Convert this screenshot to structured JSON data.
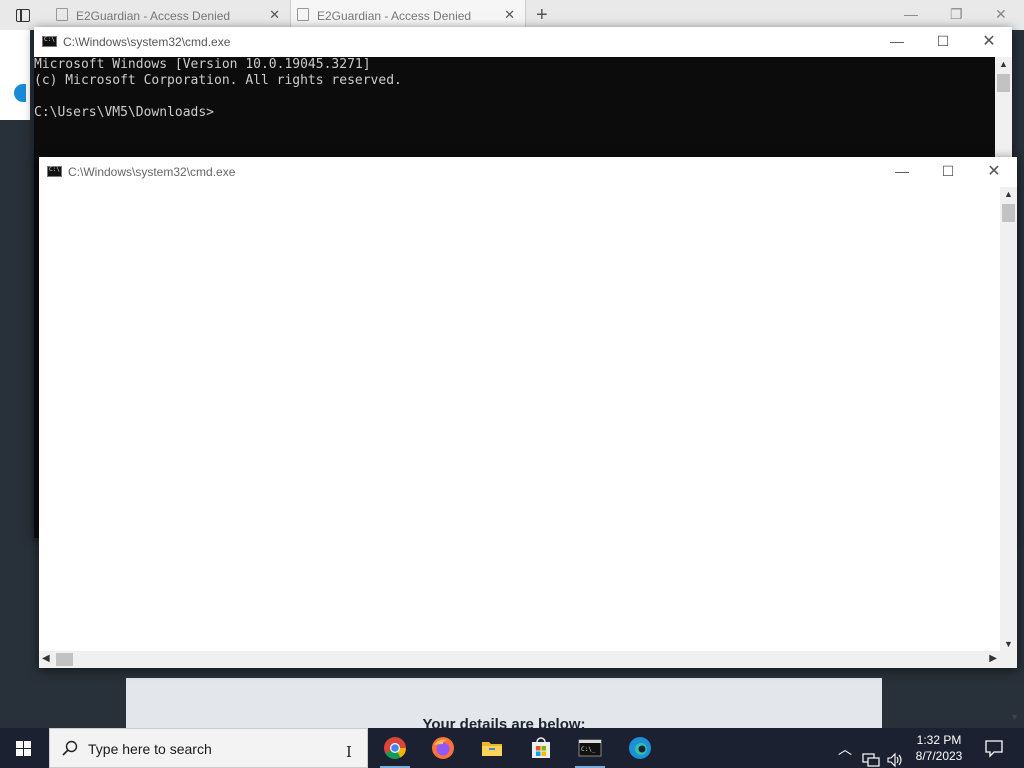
{
  "browser": {
    "tabs": [
      {
        "title": "E2Guardian - Access Denied"
      },
      {
        "title": "E2Guardian - Access Denied"
      }
    ],
    "page_heading": "Your details are below:"
  },
  "cmd_back": {
    "title": "C:\\Windows\\system32\\cmd.exe",
    "console_lines": [
      "Microsoft Windows [Version 10.0.19045.3271]",
      "(c) Microsoft Corporation. All rights reserved.",
      "",
      "C:\\Users\\VM5\\Downloads>"
    ]
  },
  "cmd_front": {
    "title": "C:\\Windows\\system32\\cmd.exe"
  },
  "taskbar": {
    "search_placeholder": "Type here to search",
    "clock_time": "1:32 PM",
    "clock_date": "8/7/2023",
    "apps": [
      "chrome-icon",
      "firefox-icon",
      "file-explorer-icon",
      "store-icon",
      "terminal-icon",
      "edge-icon"
    ]
  }
}
